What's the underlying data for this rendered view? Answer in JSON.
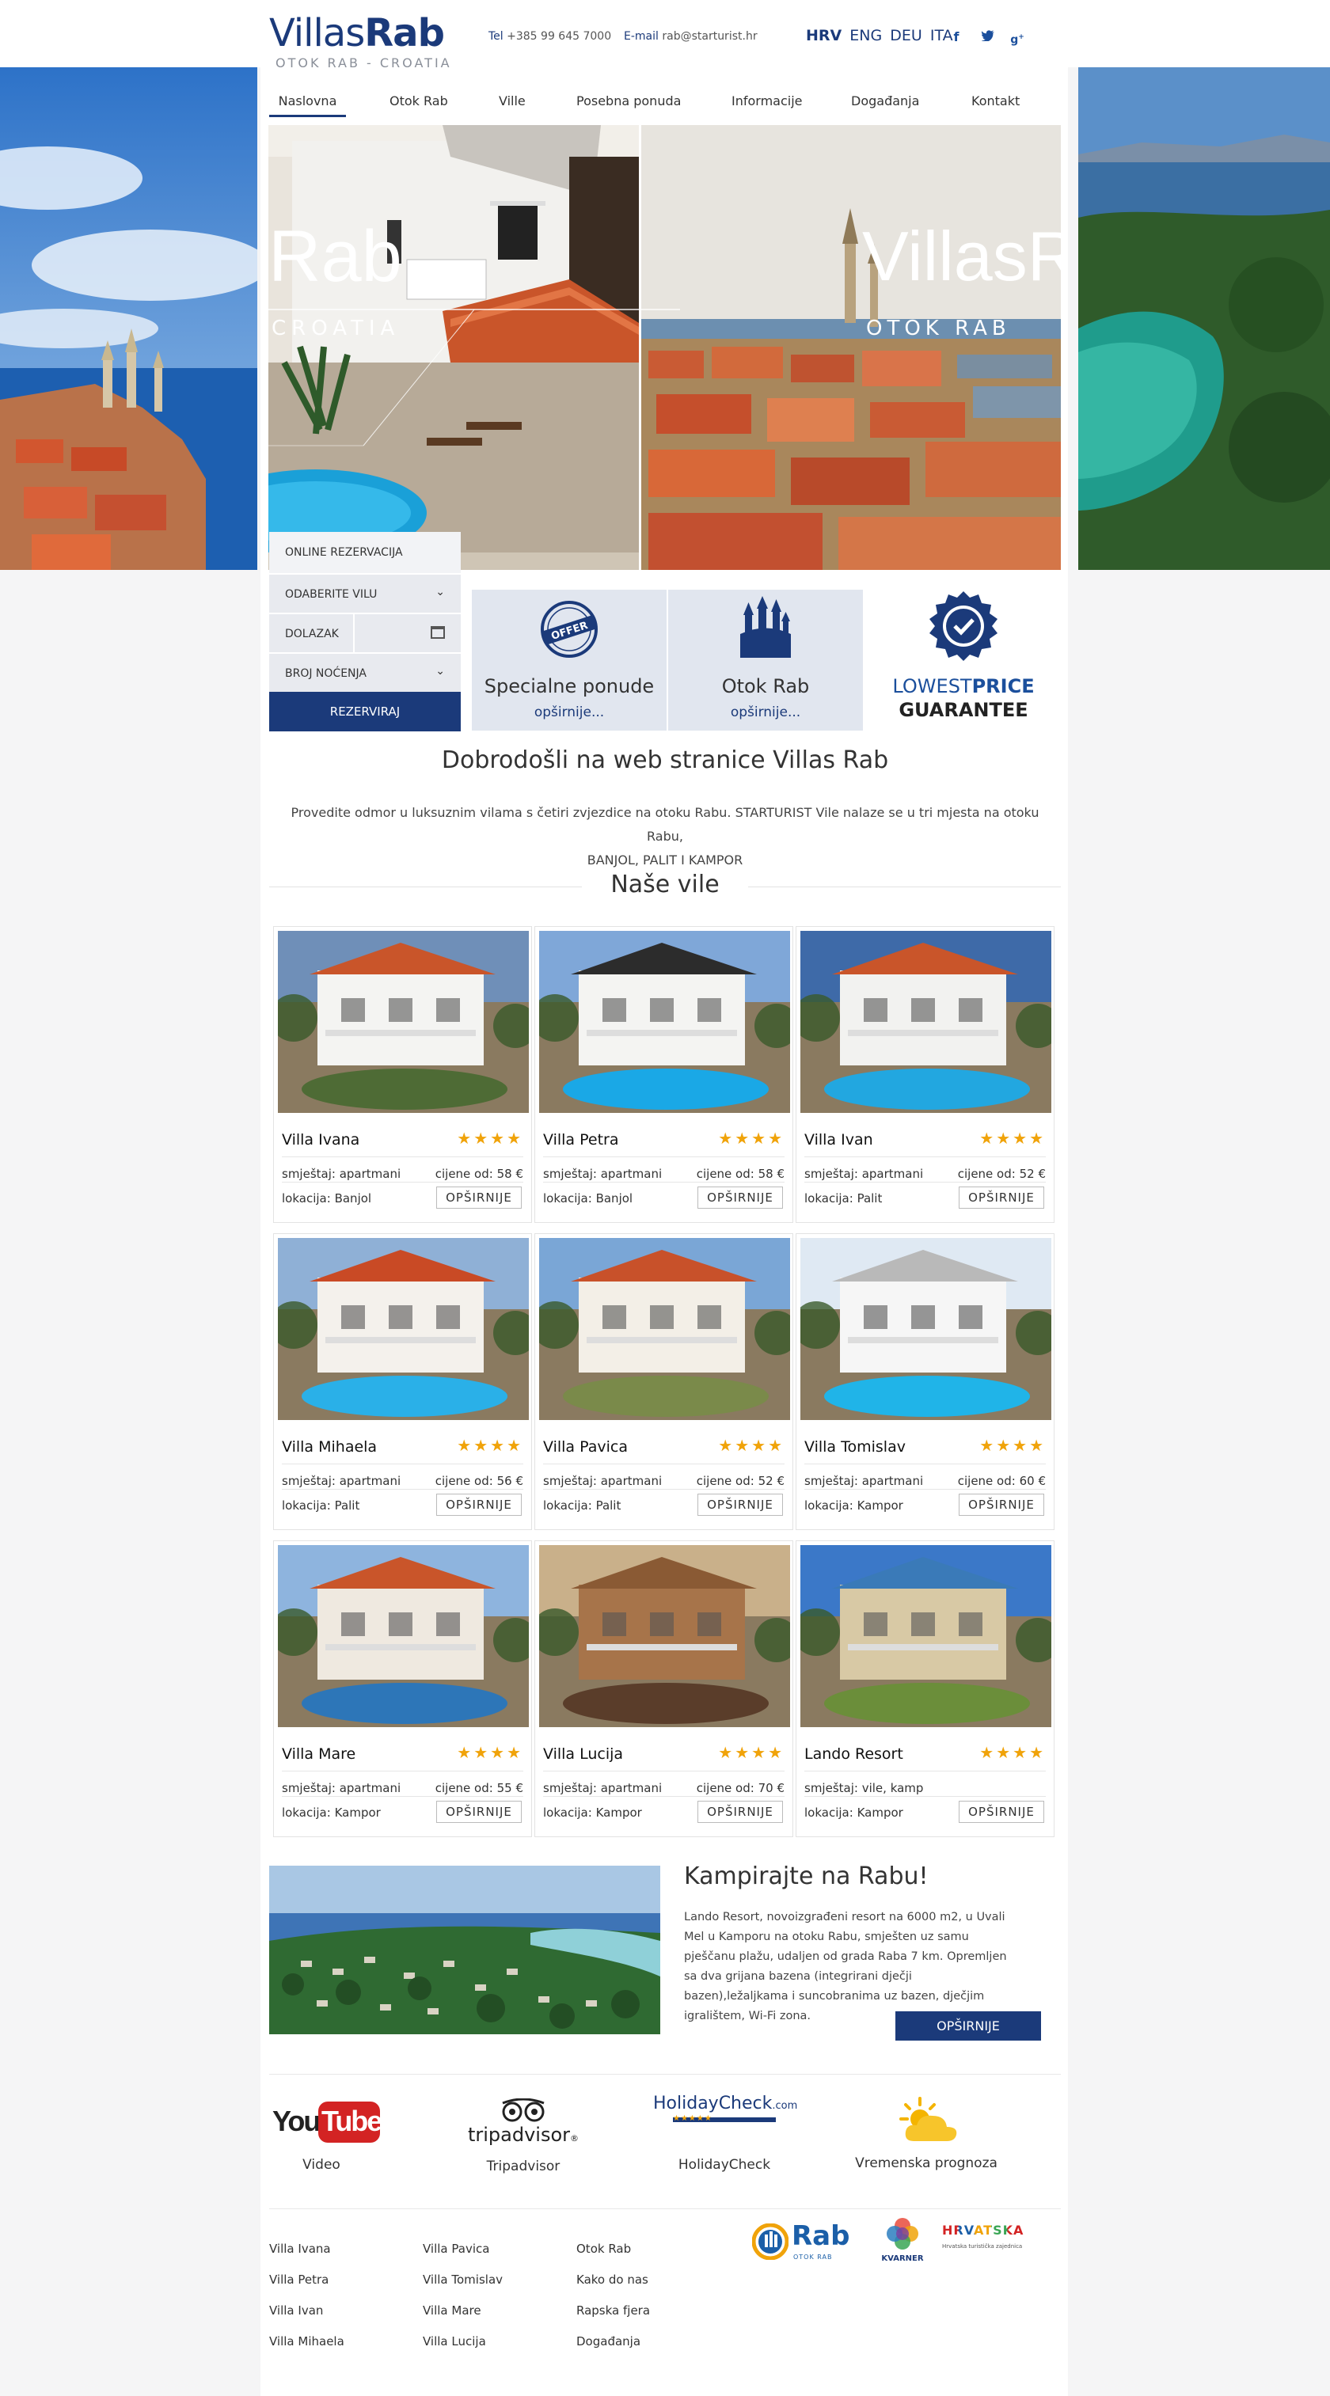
{
  "header": {
    "logo_light": "Villas",
    "logo_bold": "Rab",
    "logo_sub": "OTOK RAB - CROATIA",
    "tel_label": "Tel",
    "tel_value": "+385 99 645 7000",
    "email_label": "E-mail",
    "email_value": "rab@starturist.hr",
    "languages": [
      "HRV",
      "ENG",
      "DEU",
      "ITA"
    ],
    "active_language": "HRV",
    "social": [
      "facebook-icon",
      "twitter-icon",
      "google-plus-icon"
    ]
  },
  "nav": {
    "items": [
      "Naslovna",
      "Otok Rab",
      "Ville",
      "Posebna ponuda",
      "Informacije",
      "Događanja",
      "Kontakt"
    ],
    "active": "Naslovna"
  },
  "hero": {
    "left_title": "Rab",
    "left_sub": "CROATIA",
    "right_title": "VillasR",
    "right_sub": "OTOK RAB"
  },
  "booking": {
    "title": "ONLINE REZERVACIJA",
    "villa_select": "ODABERITE VILU",
    "arrival": "DOLAZAK",
    "nights": "BROJ NOĆENJA",
    "submit": "REZERVIRAJ"
  },
  "tiles": {
    "offers_title": "Specialne ponude",
    "offers_more": "opširnije...",
    "island_title": "Otok Rab",
    "island_more": "opširnije...",
    "guarantee_light": "LOWEST",
    "guarantee_bold": "PRICE",
    "guarantee_line2": "GUARANTEE",
    "offer_badge": "OFFER"
  },
  "welcome": {
    "title": "Dobrodošli na web stranice Villas Rab",
    "line1": "Provedite odmor u luksuznim vilama s četiri zvjezdice na otoku Rabu. STARTURIST Vile nalaze se u tri mjesta na otoku Rabu,",
    "line2": "BANJOL, PALIT I KAMPOR"
  },
  "villas_section": {
    "title": "Naše vile"
  },
  "villas": [
    {
      "name": "Villa Ivana",
      "stars": "★★★★",
      "acc_label": "smještaj:",
      "acc_value": "apartmani",
      "price_label": "cijene od:",
      "price": "58 €",
      "loc_label": "lokacija:",
      "loc": "Banjol",
      "btn": "OPŠIRNIJE"
    },
    {
      "name": "Villa Petra",
      "stars": "★★★★",
      "acc_label": "smještaj:",
      "acc_value": "apartmani",
      "price_label": "cijene od:",
      "price": "58 €",
      "loc_label": "lokacija:",
      "loc": "Banjol",
      "btn": "OPŠIRNIJE"
    },
    {
      "name": "Villa Ivan",
      "stars": "★★★★",
      "acc_label": "smještaj:",
      "acc_value": "apartmani",
      "price_label": "cijene od:",
      "price": "52 €",
      "loc_label": "lokacija:",
      "loc": "Palit",
      "btn": "OPŠIRNIJE"
    },
    {
      "name": "Villa Mihaela",
      "stars": "★★★★",
      "acc_label": "smještaj:",
      "acc_value": "apartmani",
      "price_label": "cijene od:",
      "price": "56 €",
      "loc_label": "lokacija:",
      "loc": "Palit",
      "btn": "OPŠIRNIJE"
    },
    {
      "name": "Villa Pavica",
      "stars": "★★★★",
      "acc_label": "smještaj:",
      "acc_value": "apartmani",
      "price_label": "cijene od:",
      "price": "52 €",
      "loc_label": "lokacija:",
      "loc": "Palit",
      "btn": "OPŠIRNIJE"
    },
    {
      "name": "Villa Tomislav",
      "stars": "★★★★",
      "acc_label": "smještaj:",
      "acc_value": "apartmani",
      "price_label": "cijene od:",
      "price": "60 €",
      "loc_label": "lokacija:",
      "loc": "Kampor",
      "btn": "OPŠIRNIJE"
    },
    {
      "name": "Villa Mare",
      "stars": "★★★★",
      "acc_label": "smještaj:",
      "acc_value": "apartmani",
      "price_label": "cijene od:",
      "price": "55 €",
      "loc_label": "lokacija:",
      "loc": "Kampor",
      "btn": "OPŠIRNIJE"
    },
    {
      "name": "Villa Lucija",
      "stars": "★★★★",
      "acc_label": "smještaj:",
      "acc_value": "apartmani",
      "price_label": "cijene od:",
      "price": "70 €",
      "loc_label": "lokacija:",
      "loc": "Kampor",
      "btn": "OPŠIRNIJE"
    },
    {
      "name": "Lando Resort",
      "stars": "★★★★",
      "acc_label": "smještaj:",
      "acc_value": "vile, kamp",
      "price_label": "",
      "price": "",
      "loc_label": "lokacija:",
      "loc": "Kampor",
      "btn": "OPŠIRNIJE"
    }
  ],
  "camping": {
    "title": "Kampirajte na Rabu!",
    "text": "Lando Resort, novoizgrađeni resort na 6000 m2, u Uvali Mel u Kamporu na otoku Rabu, smješten uz samu pješčanu plažu, udaljen od grada Raba 7 km. Opremljen sa dva grijana bazena (integrirani dječji bazen),ležaljkama i suncobranima uz bazen, dječjim igralištem, Wi-Fi zona.",
    "button": "OPŠIRNIJE"
  },
  "partners": [
    {
      "label": "Video",
      "logo_a": "You",
      "logo_b": "Tube"
    },
    {
      "label": "Tripadvisor",
      "logo_a": "tripadvisor",
      "logo_b": "®"
    },
    {
      "label": "HolidayCheck",
      "logo_a": "HolidayCheck",
      "logo_b": ".com"
    },
    {
      "label": "Vremenska prognoza",
      "logo_a": "",
      "logo_b": ""
    }
  ],
  "footer": {
    "col1": [
      "Villa Ivana",
      "Villa Petra",
      "Villa Ivan",
      "Villa Mihaela"
    ],
    "col2": [
      "Villa Pavica",
      "Villa Tomislav",
      "Villa Mare",
      "Villa Lucija"
    ],
    "col3": [
      "Otok Rab",
      "Kako do nas",
      "Rapska fjera",
      "Događanja"
    ],
    "logo_rab": "Rab",
    "logo_rab_sub": "OTOK RAB",
    "logo_kvarner": "KVARNER",
    "logo_hrvatska": "HRVATSKA",
    "logo_hrvatska_sub": "Hrvatska turistička zajednica"
  },
  "colors": {
    "brand": "#1b3a7a",
    "star": "#f0a30a",
    "tile": "#e1e6ef"
  }
}
